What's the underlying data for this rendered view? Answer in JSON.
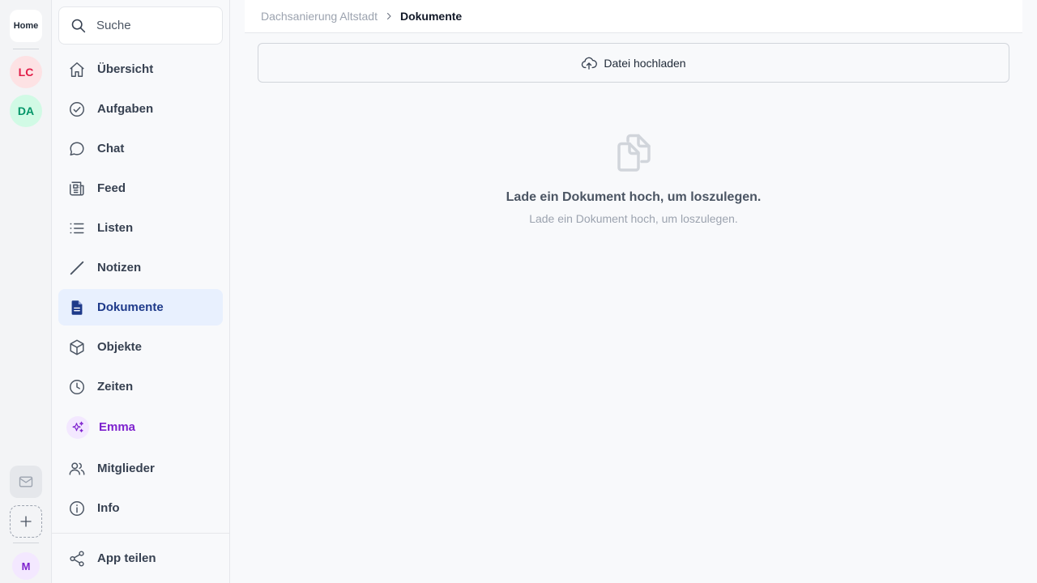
{
  "rail": {
    "home_label": "Home",
    "workspaces": [
      {
        "initials": "LC",
        "bg": "#fde2e4",
        "color": "#e11d48"
      },
      {
        "initials": "DA",
        "bg": "#d1fae5",
        "color": "#059669"
      }
    ],
    "mail_icon": "mail-icon",
    "add_icon": "plus-icon",
    "user": {
      "initials": "M",
      "bg": "#f3e8ff",
      "color": "#7e22ce"
    }
  },
  "sidebar": {
    "search_placeholder": "Suche",
    "items": [
      {
        "label": "Übersicht",
        "icon": "home-icon"
      },
      {
        "label": "Aufgaben",
        "icon": "check-circle-icon"
      },
      {
        "label": "Chat",
        "icon": "chat-bubble-icon"
      },
      {
        "label": "Feed",
        "icon": "newspaper-icon"
      },
      {
        "label": "Listen",
        "icon": "list-icon"
      },
      {
        "label": "Notizen",
        "icon": "pencil-icon"
      },
      {
        "label": "Dokumente",
        "icon": "document-icon",
        "active": true
      },
      {
        "label": "Objekte",
        "icon": "cube-icon"
      },
      {
        "label": "Zeiten",
        "icon": "clock-icon"
      },
      {
        "label": "Emma",
        "icon": "sparkles-icon"
      },
      {
        "label": "Mitglieder",
        "icon": "users-icon"
      },
      {
        "label": "Info",
        "icon": "info-icon"
      }
    ],
    "share_label": "App teilen",
    "share_icon": "share-icon"
  },
  "breadcrumb": {
    "parent": "Dachsanierung Altstadt",
    "current": "Dokumente"
  },
  "upload": {
    "label": "Datei hochladen",
    "icon": "cloud-upload-icon"
  },
  "empty_state": {
    "icon": "documents-icon",
    "title": "Lade ein Dokument hoch, um loszulegen.",
    "subtitle": "Lade ein Dokument hoch, um loszulegen."
  },
  "colors": {
    "active_bg": "#e8f0fe",
    "active_text": "#1e3a8a",
    "emma_text": "#7e22ce"
  }
}
